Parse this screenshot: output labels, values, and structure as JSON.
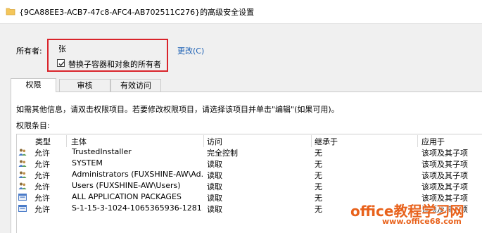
{
  "window": {
    "title": "{9CA88EE3-ACB7-47c8-AFC4-AB702511C276}的高级安全设置"
  },
  "owner": {
    "label": "所有者:",
    "name": "张",
    "change_link": "更改(C)",
    "replace_checkbox_label": "替换子容器和对象的所有者",
    "replace_checked": true
  },
  "tabs": [
    {
      "label": "权限",
      "active": true
    },
    {
      "label": "审核",
      "active": false
    },
    {
      "label": "有效访问",
      "active": false
    }
  ],
  "info_text": "如需其他信息，请双击权限项目。若要修改权限项目，请选择该项目并单击\"编辑\"(如果可用)。",
  "entries_label": "权限条目:",
  "table": {
    "columns": [
      "类型",
      "主体",
      "访问",
      "继承于",
      "应用于"
    ],
    "rows": [
      {
        "icon": "user-group-icon",
        "type": "允许",
        "principal": "TrustedInstaller",
        "access": "完全控制",
        "inherited": "无",
        "applies": "该项及其子项"
      },
      {
        "icon": "user-group-icon",
        "type": "允许",
        "principal": "SYSTEM",
        "access": "读取",
        "inherited": "无",
        "applies": "该项及其子项"
      },
      {
        "icon": "user-group-icon",
        "type": "允许",
        "principal": "Administrators (FUXSHINE-AW\\Ad...",
        "access": "读取",
        "inherited": "无",
        "applies": "该项及其子项"
      },
      {
        "icon": "user-group-icon",
        "type": "允许",
        "principal": "Users (FUXSHINE-AW\\Users)",
        "access": "读取",
        "inherited": "无",
        "applies": "该项及其子项"
      },
      {
        "icon": "app-package-icon",
        "type": "允许",
        "principal": "ALL APPLICATION PACKAGES",
        "access": "读取",
        "inherited": "无",
        "applies": "该项及其子项"
      },
      {
        "icon": "app-package-icon",
        "type": "允许",
        "principal": "S-1-15-3-1024-1065365936-1281...",
        "access": "读取",
        "inherited": "无",
        "applies": "该项及其子项"
      }
    ]
  },
  "watermark": {
    "brand": "office教程学习网",
    "url": "www.office68.com"
  },
  "colors": {
    "highlight_border": "#d9242b",
    "link": "#1a5fb4",
    "watermark": "#e8621c"
  }
}
